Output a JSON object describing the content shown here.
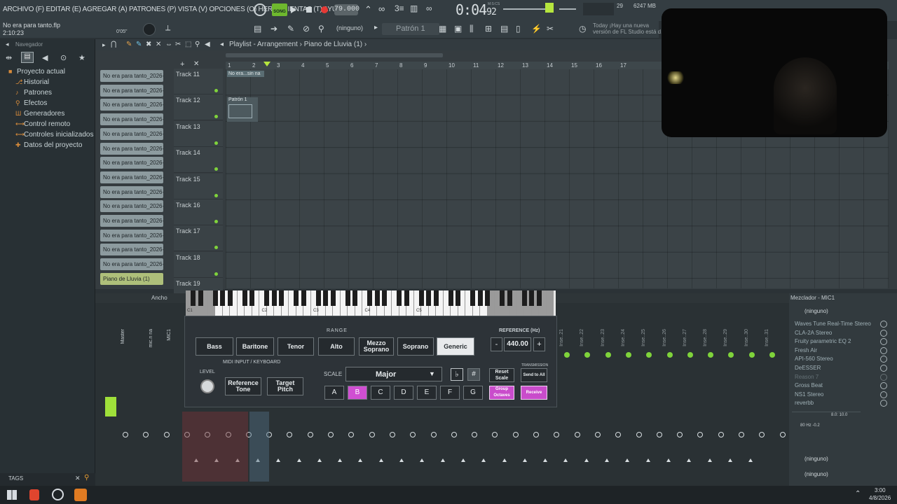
{
  "menubar": {
    "menus": "ARCHIVO (F) EDITAR (E) AGREGAR (A) PATRONES (P) VISTA (V) OPCIONES (O) HERRAMIENTAS (T) AYUDA",
    "song_label": "SONG",
    "tempo": "79.000",
    "time": "0:04",
    "time_frac": "92",
    "time_unit": "M:S:CS",
    "cpu": "29",
    "memory": "6247 MB"
  },
  "project": {
    "filename": "No era para tanto.flp",
    "length": "2:10:23",
    "time_offset": "0'05\""
  },
  "toolbar": {
    "pattern_select": "(ninguno)",
    "pattern_name": "Patrón 1",
    "news_line1": "Today  ¡Hay una nueva",
    "news_line2": "versión de FL Studio está d..."
  },
  "browser": {
    "title": "Navegador",
    "items": [
      "Proyecto actual",
      "Historial",
      "Patrones",
      "Efectos",
      "Generadores",
      "Control remoto",
      "Controles inicializados",
      "Datos del proyecto"
    ],
    "tags_label": "TAGS"
  },
  "playlist": {
    "title": "Playlist - Arrangement",
    "breadcrumb_sep": "›",
    "current_pattern": "Piano de Lluvia (1)",
    "ruler": [
      "1",
      "2",
      "3",
      "4",
      "5",
      "6",
      "7",
      "8",
      "9",
      "10",
      "11",
      "12",
      "13",
      "14",
      "15",
      "16",
      "17"
    ],
    "patterns": [
      "No era para tanto_2026-...",
      "No era para tanto_2026-...",
      "No era para tanto_2026-...",
      "No era para tanto_2026-...",
      "No era para tanto_2026-...",
      "No era para tanto_2026-...",
      "No era para tanto_2026-...",
      "No era para tanto_2026-...",
      "No era para tanto_2026-...",
      "No era para tanto_2026-...",
      "No era para tanto_2026-...",
      "No era para tanto_2026-...",
      "No era para tanto_2026-...",
      "No era para tanto_2026-...",
      "Piano de Lluvia (1)"
    ],
    "tracks": [
      "Track 11",
      "Track 12",
      "Track 13",
      "Track 14",
      "Track 15",
      "Track 16",
      "Track 17",
      "Track 18",
      "Track 19"
    ],
    "clip1": "No era...sin na",
    "clip2": "Patrón 1"
  },
  "pitch_tool": {
    "range_label": "RANGE",
    "ranges": [
      "Bass",
      "Baritone",
      "Tenor",
      "Alto",
      "Mezzo Soprano",
      "Soprano",
      "Generic"
    ],
    "selected_range": "Generic",
    "reference_label": "REFERENCE (Hz)",
    "reference_value": "440.00",
    "minus": "-",
    "plus": "+",
    "midi_label": "MIDI INPUT / KEYBOARD",
    "level_label": "LEVEL",
    "reference_tone": "Reference Tone",
    "target_pitch": "Target Pitch",
    "scale_label": "SCALE",
    "scale_value": "Major",
    "flat": "♭",
    "sharp": "#",
    "reset_scale": "Reset Scale",
    "transmission_label": "TRANSMISSION",
    "send_to_all": "Send to All",
    "notes": [
      "A",
      "B",
      "C",
      "D",
      "E",
      "F",
      "G"
    ],
    "selected_note": "B",
    "group_octaves": "Group Octaves",
    "receive": "Receive",
    "keyboard_labels": [
      "C1",
      "C2",
      "C3",
      "C4",
      "C5"
    ]
  },
  "mixer": {
    "header": "Ancho",
    "title": "Mezclador - MIC1",
    "input": "(ninguno)",
    "strips": [
      "Master",
      "mic.n na",
      "MIC1"
    ],
    "inserts": [
      "Inse..21",
      "Inse..22",
      "Inse..23",
      "Inse..24",
      "Inse..25",
      "Inse..26",
      "Inse..27",
      "Inse..28",
      "Inse..29",
      "Inse..30",
      "Inse..31"
    ],
    "slots": [
      "Waves Tune Real-Time Stereo",
      "CLA-2A Stereo",
      "Fruity parametric EQ 2",
      "Fresh Air",
      "API-560 Stereo",
      "DeESSER",
      "Reason 7",
      "Gross Beat",
      "NS1 Stereo",
      "reverbb"
    ],
    "eq_readout": "8.0: 10.0",
    "eq_readout2": "80 Hz -0.2",
    "output_slot1": "(ninguno)",
    "output_slot2": "(ninguno)"
  },
  "taskbar": {
    "time": "3:00",
    "date": "4/8/2026"
  }
}
